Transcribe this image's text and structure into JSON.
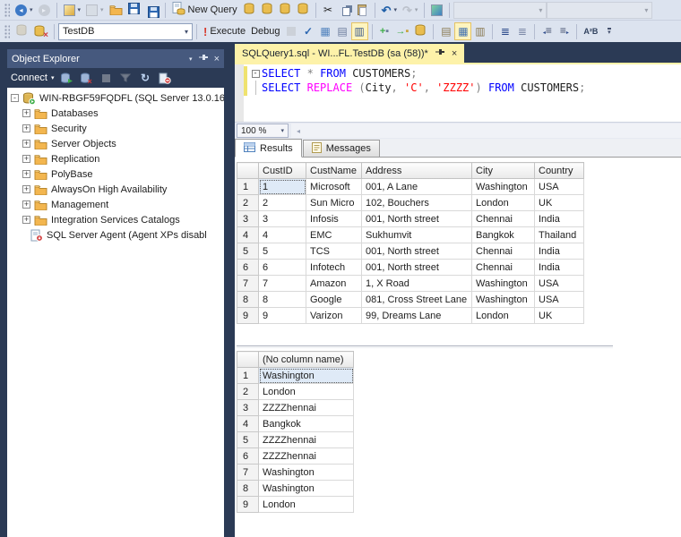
{
  "colors": {
    "accent_navy": "#2b3a55",
    "toolbar_bg": "#dce3ef",
    "active_tab_yellow": "#fdf2a9",
    "panel_title_bg": "#46597e",
    "keyword": "#0000ff",
    "function": "#ff00ff",
    "string": "#ff0000",
    "operator": "#808080",
    "selected_cell_bg": "#dfeaf7"
  },
  "toolbar_main": {
    "items": [
      {
        "type": "grip",
        "name": "toolbar-grip"
      },
      {
        "type": "icon",
        "name": "back-button",
        "glyph": "back",
        "chev": true
      },
      {
        "type": "icon",
        "name": "forward-button",
        "glyph": "forward",
        "dim": true
      },
      {
        "type": "sep"
      },
      {
        "type": "icon",
        "name": "new-project-button",
        "glyph": "newproj",
        "chev": true
      },
      {
        "type": "icon",
        "name": "add-item-button",
        "glyph": "additem",
        "chev": true,
        "dim": true
      },
      {
        "type": "icon",
        "name": "open-file-button",
        "glyph": "folder"
      },
      {
        "type": "icon",
        "name": "save-button",
        "glyph": "save"
      },
      {
        "type": "icon",
        "name": "save-all-button",
        "glyph": "saveall"
      },
      {
        "type": "sep"
      },
      {
        "type": "button",
        "name": "new-query-button",
        "glyph": "newquery",
        "label": "New Query"
      },
      {
        "type": "icon",
        "name": "database-engine-query-button",
        "glyph": "dbquery"
      },
      {
        "type": "icon",
        "name": "analysis-mdx-query-button",
        "glyph": "dbquery"
      },
      {
        "type": "icon",
        "name": "analysis-dmx-query-button",
        "glyph": "dbquery"
      },
      {
        "type": "icon",
        "name": "analysis-xmla-query-button",
        "glyph": "dbquery"
      },
      {
        "type": "sep"
      },
      {
        "type": "icon",
        "name": "cut-button",
        "glyph": "cut"
      },
      {
        "type": "icon",
        "name": "copy-button",
        "glyph": "copy"
      },
      {
        "type": "icon",
        "name": "paste-button",
        "glyph": "paste"
      },
      {
        "type": "sep"
      },
      {
        "type": "icon",
        "name": "undo-button",
        "glyph": "undo",
        "chev": true
      },
      {
        "type": "icon",
        "name": "redo-button",
        "glyph": "redo",
        "chev": true,
        "dim": true
      },
      {
        "type": "sep"
      },
      {
        "type": "icon",
        "name": "activity-monitor-button",
        "glyph": "activity"
      },
      {
        "type": "sep"
      },
      {
        "type": "combo",
        "name": "toolbar-combo-1",
        "value": "",
        "w": "w104",
        "dim": true
      },
      {
        "type": "combo",
        "name": "toolbar-combo-2",
        "value": "",
        "w": "w118",
        "dim": true
      }
    ]
  },
  "toolbar_query": {
    "items": [
      {
        "type": "grip",
        "name": "toolbar-grip"
      },
      {
        "type": "icon",
        "name": "connect-button",
        "glyph": "dbconnect",
        "dim": true
      },
      {
        "type": "icon",
        "name": "change-connection-button",
        "glyph": "dbchange"
      },
      {
        "type": "sep"
      },
      {
        "type": "combo",
        "name": "available-databases-combo",
        "value": "TestDB",
        "w": "w150",
        "light": true
      },
      {
        "type": "sep"
      },
      {
        "type": "button",
        "name": "execute-button",
        "glyph": "execute",
        "label": "Execute"
      },
      {
        "type": "button",
        "name": "debug-button",
        "label": "Debug"
      },
      {
        "type": "icon",
        "name": "stop-button",
        "glyph": "stop",
        "dim": true
      },
      {
        "type": "icon",
        "name": "parse-button",
        "glyph": "parse"
      },
      {
        "type": "icon",
        "name": "estimated-plan-button",
        "glyph": "estplan"
      },
      {
        "type": "icon",
        "name": "query-options-button",
        "glyph": "queryopt"
      },
      {
        "type": "icon",
        "name": "intellisense-toggle",
        "glyph": "intellisense",
        "toggled": true
      },
      {
        "type": "sep"
      },
      {
        "type": "icon",
        "name": "template-parameters-button",
        "glyph": "tparams"
      },
      {
        "type": "icon",
        "name": "analyze-query-button",
        "glyph": "analyze"
      },
      {
        "type": "icon",
        "name": "database-tuning-button",
        "glyph": "dbcopy"
      },
      {
        "type": "sep"
      },
      {
        "type": "icon",
        "name": "results-to-text-button",
        "glyph": "restext"
      },
      {
        "type": "icon",
        "name": "results-to-grid-toggle",
        "glyph": "resgrid",
        "toggled": true
      },
      {
        "type": "icon",
        "name": "results-to-file-button",
        "glyph": "resfile"
      },
      {
        "type": "sep"
      },
      {
        "type": "icon",
        "name": "comment-lines-button",
        "glyph": "comment"
      },
      {
        "type": "icon",
        "name": "uncomment-lines-button",
        "glyph": "uncomment"
      },
      {
        "type": "sep"
      },
      {
        "type": "icon",
        "name": "decrease-indent-button",
        "glyph": "outdent"
      },
      {
        "type": "icon",
        "name": "increase-indent-button",
        "glyph": "indent"
      },
      {
        "type": "sep"
      },
      {
        "type": "icon",
        "name": "complete-word-button",
        "glyph": "completeword"
      },
      {
        "type": "icon",
        "name": "toolbar-overflow-button",
        "glyph": "overflow"
      }
    ]
  },
  "object_explorer": {
    "title": "Object Explorer",
    "connect_label": "Connect",
    "toolbar_icons": [
      "connect-icon",
      "disconnect-icon",
      "stop-icon",
      "filter-icon",
      "refresh-icon",
      "disconnect-all-icon"
    ],
    "tree": {
      "root_label": "WIN-RBGF59FQDFL (SQL Server 13.0.16",
      "folders": [
        "Databases",
        "Security",
        "Server Objects",
        "Replication",
        "PolyBase",
        "AlwaysOn High Availability",
        "Management",
        "Integration Services Catalogs"
      ],
      "agent_label": "SQL Server Agent (Agent XPs disabl"
    }
  },
  "editor": {
    "tab_title": "SQLQuery1.sql - WI...FL.TestDB (sa (58))*",
    "zoom_value": "100 %",
    "code_lines": [
      {
        "fold": "minus",
        "tokens": [
          {
            "t": "SELECT",
            "c": "kw"
          },
          {
            "t": " "
          },
          {
            "t": "*",
            "c": "op"
          },
          {
            "t": " "
          },
          {
            "t": "FROM",
            "c": "kw"
          },
          {
            "t": " CUSTOMERS"
          },
          {
            "t": ";",
            "c": "op"
          }
        ]
      },
      {
        "fold": "line",
        "tokens": [
          {
            "t": "SELECT",
            "c": "kw"
          },
          {
            "t": " "
          },
          {
            "t": "REPLACE",
            "c": "fn"
          },
          {
            "t": " "
          },
          {
            "t": "(",
            "c": "op"
          },
          {
            "t": "City"
          },
          {
            "t": ", ",
            "c": "op"
          },
          {
            "t": "'C'",
            "c": "str"
          },
          {
            "t": ", ",
            "c": "op"
          },
          {
            "t": "'ZZZZ'",
            "c": "str"
          },
          {
            "t": ")",
            "c": "op"
          },
          {
            "t": " "
          },
          {
            "t": "FROM",
            "c": "kw"
          },
          {
            "t": " CUSTOMERS"
          },
          {
            "t": ";",
            "c": "op"
          }
        ]
      }
    ]
  },
  "results_pane": {
    "tabs": [
      {
        "label": "Results",
        "icon": "results-grid-icon",
        "active": true
      },
      {
        "label": "Messages",
        "icon": "messages-icon",
        "active": false
      }
    ],
    "grids": [
      {
        "columns": [
          "CustID",
          "CustName",
          "Address",
          "City",
          "Country"
        ],
        "rows": [
          [
            "1",
            "Microsoft",
            "001, A Lane",
            "Washington",
            "USA"
          ],
          [
            "2",
            "Sun Micro",
            "102, Bouchers",
            "London",
            "UK"
          ],
          [
            "3",
            "Infosis",
            "001, North street",
            "Chennai",
            "India"
          ],
          [
            "4",
            "EMC",
            "Sukhumvit",
            "Bangkok",
            "Thailand"
          ],
          [
            "5",
            "TCS",
            "001, North street",
            "Chennai",
            "India"
          ],
          [
            "6",
            "Infotech",
            "001, North street",
            "Chennai",
            "India"
          ],
          [
            "7",
            "Amazon",
            "1, X Road",
            "Washington",
            "USA"
          ],
          [
            "8",
            "Google",
            "081, Cross Street Lane",
            "Washington",
            "USA"
          ],
          [
            "9",
            "Varizon",
            "99, Dreams Lane",
            "London",
            "UK"
          ]
        ],
        "selected_cell": {
          "row": 0,
          "col": 0
        }
      },
      {
        "columns": [
          "(No column name)"
        ],
        "rows": [
          [
            "Washington"
          ],
          [
            "London"
          ],
          [
            "ZZZZhennai"
          ],
          [
            "Bangkok"
          ],
          [
            "ZZZZhennai"
          ],
          [
            "ZZZZhennai"
          ],
          [
            "Washington"
          ],
          [
            "Washington"
          ],
          [
            "London"
          ]
        ],
        "selected_cell": {
          "row": 0,
          "col": 0
        }
      }
    ]
  }
}
